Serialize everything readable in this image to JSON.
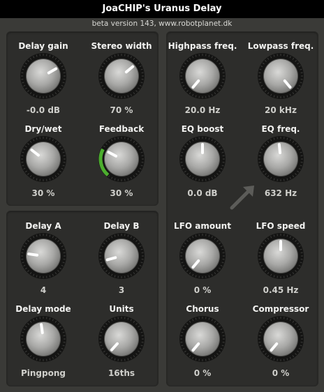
{
  "header": {
    "title": "JoaCHIP's Uranus Delay",
    "subtitle": "beta version 143, www.robotplanet.dk"
  },
  "colors": {
    "feedback_arc": "#4cae2e",
    "panel_bg": "#2d2d2b",
    "window_bg": "#3a3a37"
  },
  "icons": {
    "arrow": "diagonal-arrow-up-right-icon"
  },
  "panels": {
    "delay_main": {
      "controls": [
        {
          "id": "delay-gain",
          "label": "Delay gain",
          "value": "-0.0 dB",
          "pointer_angle_deg": 60
        },
        {
          "id": "stereo-width",
          "label": "Stereo width",
          "value": "70 %",
          "pointer_angle_deg": 50
        },
        {
          "id": "dry-wet",
          "label": "Dry/wet",
          "value": "30 %",
          "pointer_angle_deg": -52
        },
        {
          "id": "feedback",
          "label": "Feedback",
          "value": "30 %",
          "pointer_angle_deg": -62,
          "arc": true
        }
      ]
    },
    "delay_time": {
      "controls": [
        {
          "id": "delay-a",
          "label": "Delay A",
          "value": "4",
          "pointer_angle_deg": -82
        },
        {
          "id": "delay-b",
          "label": "Delay B",
          "value": "3",
          "pointer_angle_deg": -105
        },
        {
          "id": "delay-mode",
          "label": "Delay mode",
          "value": "Pingpong",
          "pointer_angle_deg": -8
        },
        {
          "id": "units",
          "label": "Units",
          "value": "16ths",
          "pointer_angle_deg": -138
        }
      ]
    },
    "effects": {
      "controls": [
        {
          "id": "highpass-freq",
          "label": "Highpass freq.",
          "value": "20.0 Hz",
          "pointer_angle_deg": -140
        },
        {
          "id": "lowpass-freq",
          "label": "Lowpass freq.",
          "value": "20 kHz",
          "pointer_angle_deg": 140
        },
        {
          "id": "eq-boost",
          "label": "EQ boost",
          "value": "0.0 dB",
          "pointer_angle_deg": 0
        },
        {
          "id": "eq-freq",
          "label": "EQ freq.",
          "value": "632 Hz",
          "pointer_angle_deg": -6
        },
        {
          "id": "lfo-amount",
          "label": "LFO amount",
          "value": "0 %",
          "pointer_angle_deg": -140
        },
        {
          "id": "lfo-speed",
          "label": "LFO speed",
          "value": "0.45 Hz",
          "pointer_angle_deg": 0
        },
        {
          "id": "chorus",
          "label": "Chorus",
          "value": "0 %",
          "pointer_angle_deg": -140
        },
        {
          "id": "compressor",
          "label": "Compressor",
          "value": "0 %",
          "pointer_angle_deg": -140
        }
      ]
    }
  }
}
